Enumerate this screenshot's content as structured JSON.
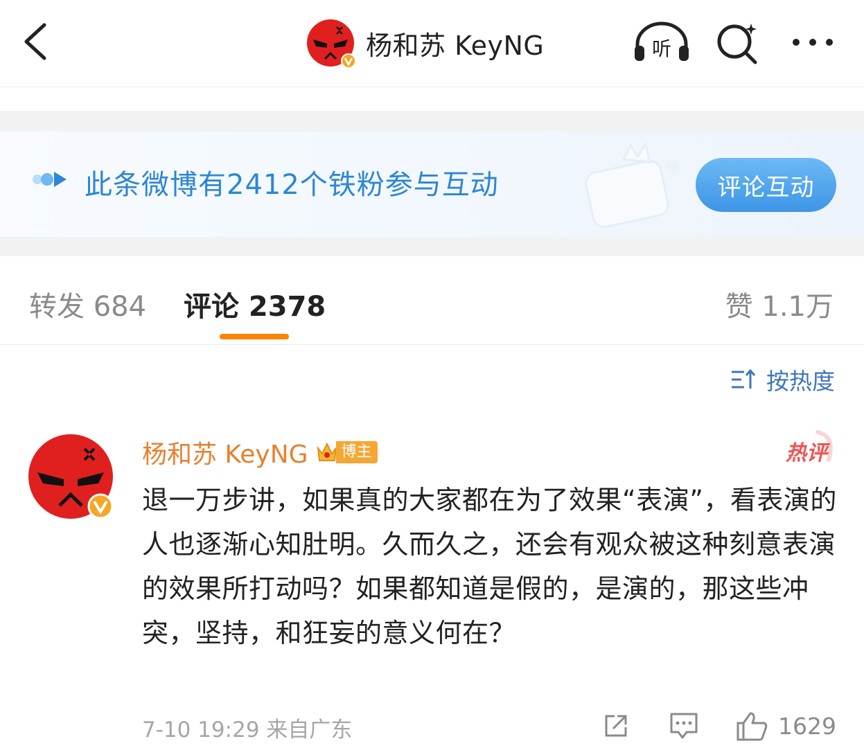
{
  "nav": {
    "title": "杨和苏 KeyNG",
    "listen_label": "听"
  },
  "banner": {
    "text": "此条微博有2412个铁粉参与互动",
    "button": "评论互动"
  },
  "tabs": {
    "repost": "转发 684",
    "comment": "评论 2378",
    "like": "赞 1.1万"
  },
  "sort": {
    "label": "按热度"
  },
  "comment": {
    "author": "杨和苏 KeyNG",
    "badge": "博主",
    "hot_label": "热评",
    "text": "退一万步讲，如果真的大家都在为了效果“表演”，看表演的人也逐渐心知肚明。久而久之，还会有观众被这种刻意表演的效果所打动吗？如果都知道是假的，是演的，那这些冲突，坚持，和狂妄的意义何在？",
    "meta": "7-10 19:29 来自广东",
    "likes": "1629"
  },
  "colors": {
    "accent_orange": "#ff8200",
    "author_orange": "#e8802e",
    "link_blue": "#2d86d6",
    "avatar_red": "#e0201f",
    "verified_gold": "#f5a623"
  }
}
